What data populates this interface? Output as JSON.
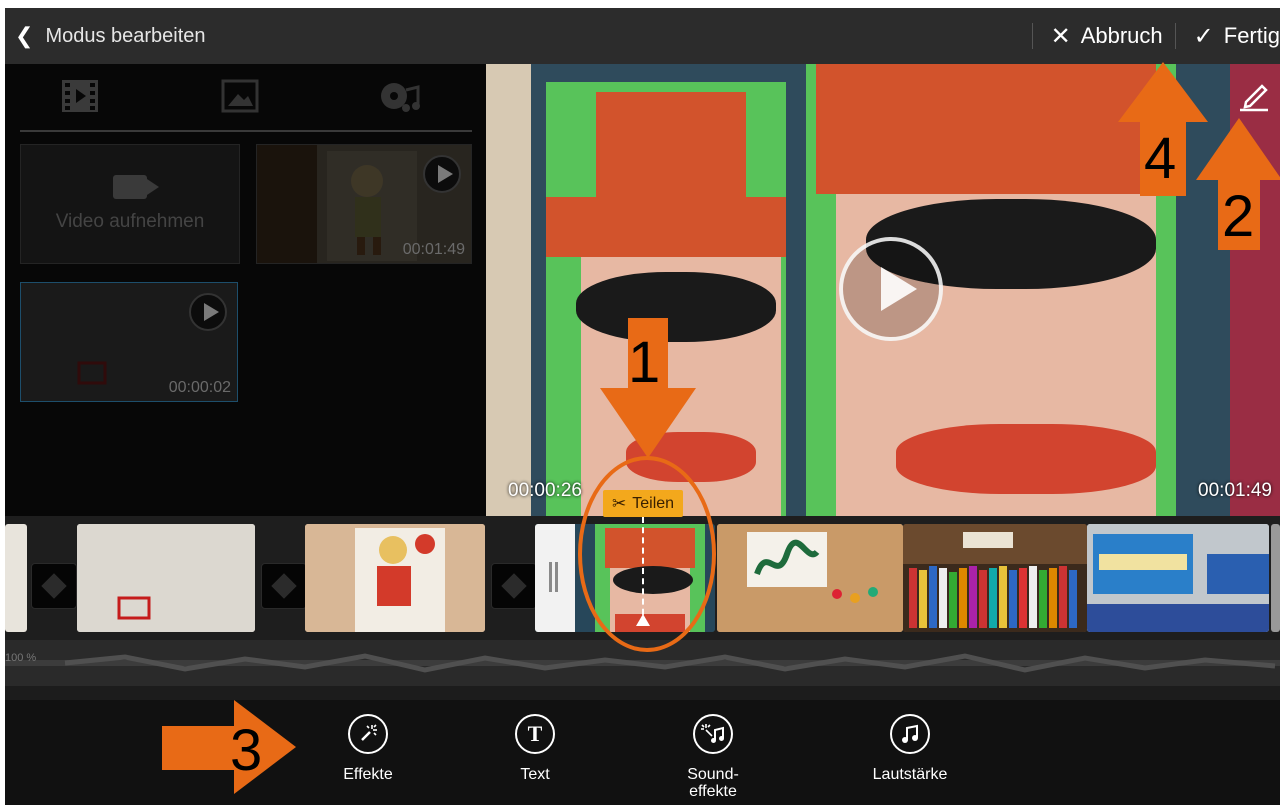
{
  "topbar": {
    "back_label": "Modus bearbeiten",
    "cancel_label": "Abbruch",
    "done_label": "Fertig"
  },
  "library": {
    "tabs": [
      "film-icon",
      "image-icon",
      "music-icon"
    ],
    "record_label": "Video aufnehmen",
    "clips": [
      {
        "duration": "00:01:49"
      },
      {
        "duration": "00:00:02"
      }
    ]
  },
  "preview": {
    "start_time": "00:00:26",
    "end_time": "00:01:49"
  },
  "timeline": {
    "split_label": "Teilen",
    "audio_level": "100 %"
  },
  "toolbar": {
    "effects_label": "Effekte",
    "text_label": "Text",
    "text_glyph": "T",
    "sound_label_1": "Sound-",
    "sound_label_2": "effekte",
    "volume_label": "Lautstärke"
  },
  "annotations": {
    "one": "1",
    "two": "2",
    "three": "3",
    "four": "4"
  },
  "colors": {
    "accent_orange": "#e86a16",
    "split_tag": "#f3a81c",
    "topbar": "#2c2c2c"
  }
}
